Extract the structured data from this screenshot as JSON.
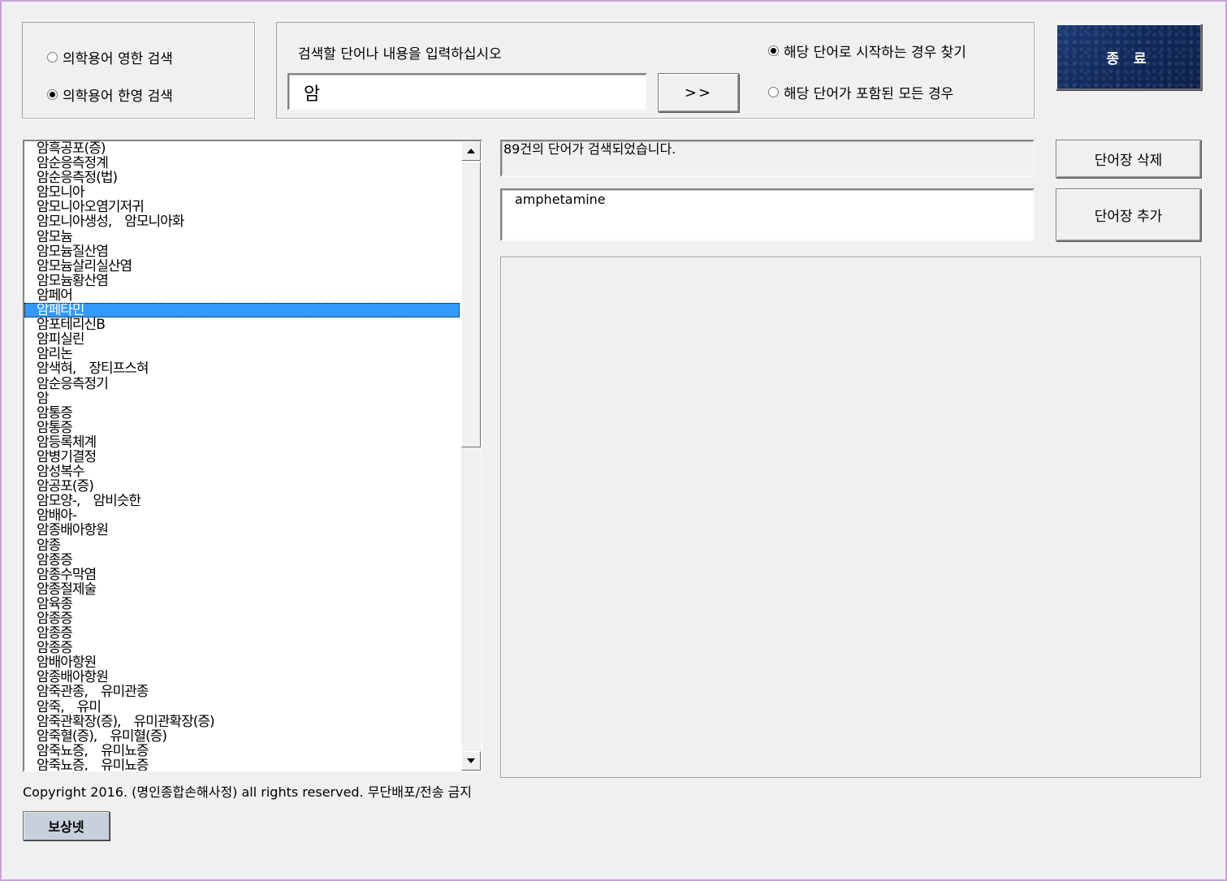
{
  "search_mode": {
    "options": [
      {
        "label": "의학용어 영한 검색",
        "checked": false
      },
      {
        "label": "의학용어 한영 검색",
        "checked": true
      }
    ]
  },
  "search": {
    "prompt": "검색할 단어나 내용을 입력하십시오",
    "query": "암",
    "go_label": ">>"
  },
  "match_mode": {
    "options": [
      {
        "label": "해당 단어로 시작하는 경우 찾기",
        "checked": true
      },
      {
        "label": "해당 단어가 포함된 모든 경우",
        "checked": false
      }
    ]
  },
  "exit_label": "종 료",
  "results": {
    "status": "89건의 단어가 검색되었습니다.",
    "translation": "amphetamine",
    "items": [
      "암흑공포(증)",
      "암순응측정계",
      "암순응측정(법)",
      "암모니아",
      "암모니아오염기저귀",
      "암모니아생성,　암모니아화",
      "암모늄",
      "암모늄질산염",
      "암모늄살리실산염",
      "암모늄황산염",
      "암페어",
      "암페타민",
      "암포테리신B",
      "암피실린",
      "암리논",
      "암색혀,　장티프스혀",
      "암순응측정기",
      "암",
      "암통증",
      "암통증",
      "암등록체계",
      "암병기결정",
      "암성복수",
      "암공포(증)",
      "암모양-,　암비슷한",
      "암배아-",
      "암종배아항원",
      "암종",
      "암종증",
      "암종수막염",
      "암종절제술",
      "암육종",
      "암종증",
      "암종증",
      "암종증",
      "암배아항원",
      "암종배아항원",
      "암죽관종,　유미관종",
      "암죽,　유미",
      "암죽관확장(증),　유미관확장(증)",
      "암죽혈(증),　유미혈(증)",
      "암죽뇨증,　유미뇨증",
      "암죽뇨증,　유미뇨증"
    ],
    "selected_index": 11
  },
  "wordbook": {
    "delete_label": "단어장 삭제",
    "add_label": "단어장 추가"
  },
  "footer": {
    "copyright": "Copyright 2016. (명인종합손해사정) all rights reserved. 무단배포/전송 금지",
    "bosang_label": "보상넷"
  }
}
